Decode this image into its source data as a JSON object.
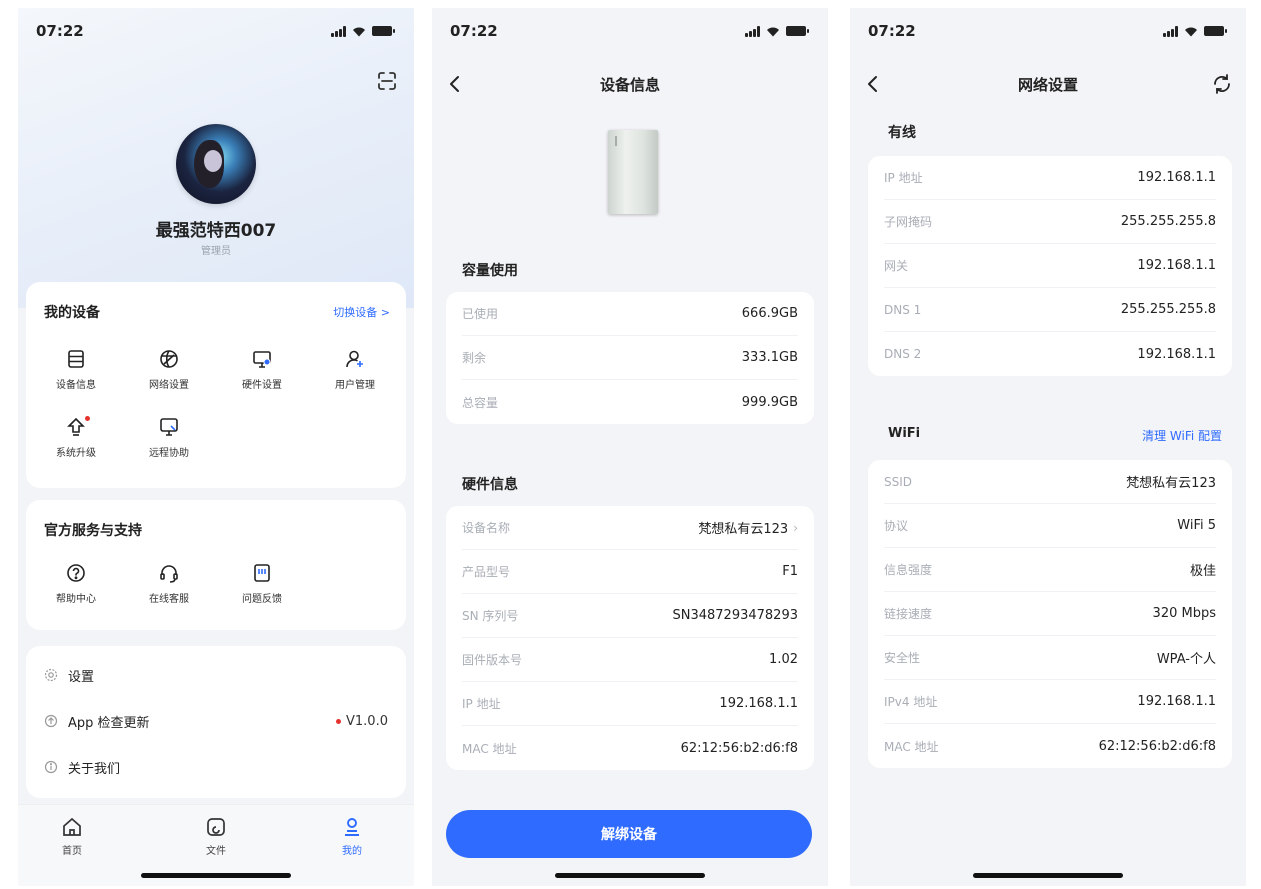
{
  "status": {
    "time": "07:22"
  },
  "profile": {
    "username": "最强范特西007",
    "role": "管理员"
  },
  "my_devices": {
    "title": "我的设备",
    "switch_label": "切换设备 >",
    "items": [
      {
        "label": "设备信息",
        "icon": "device-info-icon"
      },
      {
        "label": "网络设置",
        "icon": "network-icon"
      },
      {
        "label": "硬件设置",
        "icon": "hardware-icon"
      },
      {
        "label": "用户管理",
        "icon": "user-manage-icon"
      },
      {
        "label": "系统升级",
        "icon": "upgrade-icon"
      },
      {
        "label": "远程协助",
        "icon": "remote-assist-icon"
      }
    ]
  },
  "support": {
    "title": "官方服务与支持",
    "items": [
      {
        "label": "帮助中心",
        "icon": "help-icon"
      },
      {
        "label": "在线客服",
        "icon": "headset-icon"
      },
      {
        "label": "问题反馈",
        "icon": "feedback-icon"
      }
    ]
  },
  "menu": {
    "settings": "设置",
    "check_update": "App 检查更新",
    "version": "V1.0.0",
    "about": "关于我们"
  },
  "tabbar": {
    "home": "首页",
    "files": "文件",
    "mine": "我的"
  },
  "device_info": {
    "title": "设备信息",
    "capacity_title": "容量使用",
    "capacity": [
      {
        "key": "已使用",
        "value": "666.9GB"
      },
      {
        "key": "剩余",
        "value": "333.1GB"
      },
      {
        "key": "总容量",
        "value": "999.9GB"
      }
    ],
    "hardware_title": "硬件信息",
    "hardware": [
      {
        "key": "设备名称",
        "value": "梵想私有云123",
        "chevron": "›"
      },
      {
        "key": "产品型号",
        "value": "F1"
      },
      {
        "key": "SN 序列号",
        "value": "SN3487293478293"
      },
      {
        "key": "固件版本号",
        "value": "1.02"
      },
      {
        "key": "IP 地址",
        "value": "192.168.1.1"
      },
      {
        "key": "MAC 地址",
        "value": "62:12:56:b2:d6:f8"
      }
    ],
    "unbind_label": "解绑设备"
  },
  "network": {
    "title": "网络设置",
    "wired_title": "有线",
    "wired": [
      {
        "key": "IP 地址",
        "value": "192.168.1.1"
      },
      {
        "key": "子网掩码",
        "value": "255.255.255.8"
      },
      {
        "key": "网关",
        "value": "192.168.1.1"
      },
      {
        "key": "DNS 1",
        "value": "255.255.255.8"
      },
      {
        "key": "DNS 2",
        "value": "192.168.1.1"
      }
    ],
    "wifi_title": "WiFi",
    "wifi_clear": "清理 WiFi 配置",
    "wifi": [
      {
        "key": "SSID",
        "value": "梵想私有云123"
      },
      {
        "key": "协议",
        "value": "WiFi 5"
      },
      {
        "key": "信息强度",
        "value": "极佳"
      },
      {
        "key": "链接速度",
        "value": "320 Mbps"
      },
      {
        "key": "安全性",
        "value": "WPA-个人"
      },
      {
        "key": "IPv4 地址",
        "value": "192.168.1.1"
      },
      {
        "key": "MAC 地址",
        "value": "62:12:56:b2:d6:f8"
      }
    ]
  },
  "colors": {
    "accent": "#2f6bff",
    "badge": "#e5322d",
    "background": "#f3f4f7"
  }
}
